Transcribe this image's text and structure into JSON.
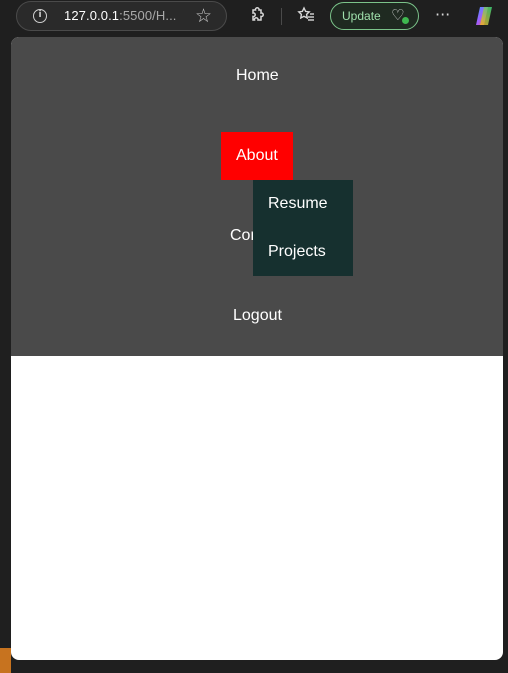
{
  "browser": {
    "url_host": "127.0.0.1",
    "url_rest": ":5500/H...",
    "update_label": "Update",
    "icons": {
      "site_info": "info-icon",
      "favorite": "star-icon",
      "extensions": "puzzle-icon",
      "favorites_bar": "favorites-icon",
      "health": "heart-pulse-icon",
      "more": "ellipsis-icon",
      "copilot": "copilot-icon"
    },
    "accent_green": "#7bc48a"
  },
  "nav": {
    "home": "Home",
    "about": "About",
    "contact": "Contact",
    "logout": "Logout",
    "about_bg": "#ff0000",
    "bar_bg": "#4a4a4a"
  },
  "dropdown": {
    "items": [
      {
        "label": "Resume"
      },
      {
        "label": "Projects"
      }
    ],
    "bg": "#16302f"
  }
}
